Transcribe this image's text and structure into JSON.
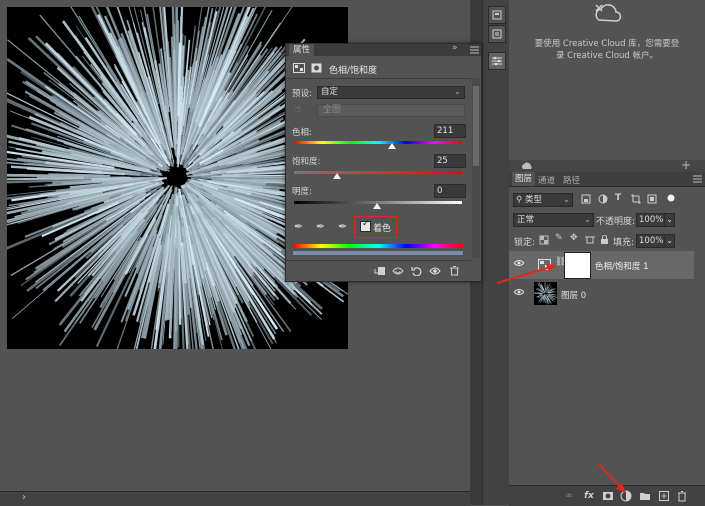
{
  "properties": {
    "panel_title": "属性",
    "collapse_glyph": "»",
    "adjustment_name": "色相/饱和度",
    "preset_label": "预设:",
    "preset_value": "自定",
    "channel_value": "全图",
    "hue_label": "色相:",
    "hue_value": "211",
    "saturation_label": "饱和度:",
    "saturation_value": "25",
    "lightness_label": "明度:",
    "lightness_value": "0",
    "colorize_label": "着色",
    "colorize_checked": true
  },
  "creative_cloud": {
    "message_line1": "要使用 Creative Cloud 库，您需要登",
    "message_line2": "录 Creative Cloud 帐户。"
  },
  "layers": {
    "tabs": [
      "图层",
      "通道",
      "路径"
    ],
    "filter_kind": "类型",
    "blend_mode": "正常",
    "opacity_label": "不透明度:",
    "opacity_value": "100%",
    "lock_label": "锁定:",
    "fill_label": "填充:",
    "fill_value": "100%",
    "items": [
      {
        "name": "色相/饱和度 1",
        "selected": true
      },
      {
        "name": "图层 0",
        "selected": false
      }
    ],
    "footer_fx": "fx"
  },
  "colors": {
    "annotation_red": "#e1261c",
    "panel_bg": "#535353",
    "selected_row": "#686868"
  },
  "icons": [
    "eye-icon",
    "link-icon",
    "new-adjustment-layer-icon",
    "trash-icon",
    "creative-cloud-icon",
    "clip-to-layer-icon",
    "reset-icon",
    "visibility-icon"
  ]
}
